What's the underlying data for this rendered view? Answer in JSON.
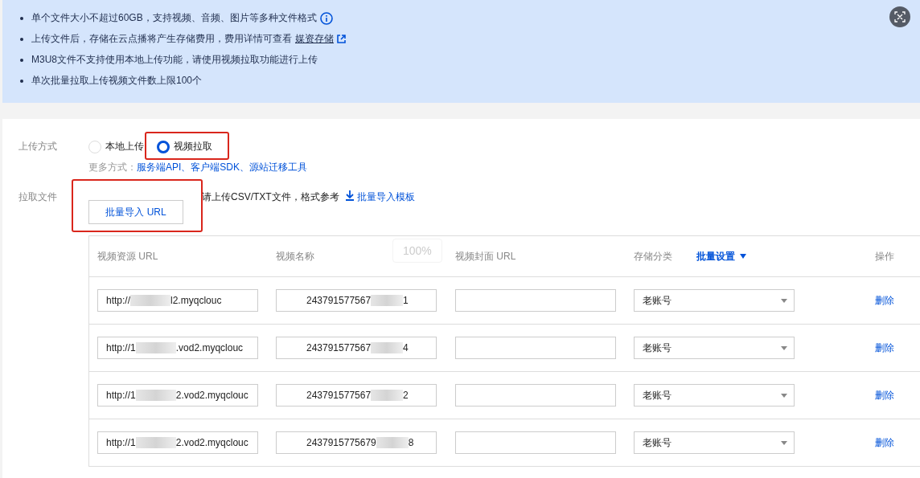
{
  "notice": {
    "items": [
      {
        "text": "单个文件大小不超过60GB，支持视频、音频、图片等多种文件格式",
        "info": true
      },
      {
        "text": "上传文件后，存储在云点播将产生存储费用，费用详情可查看",
        "link": "媒资存储"
      },
      {
        "text": "M3U8文件不支持使用本地上传功能，请使用视频拉取功能进行上传"
      },
      {
        "text": "单次批量拉取上传视频文件数上限100个"
      }
    ]
  },
  "upload_method": {
    "label": "上传方式",
    "options": [
      {
        "label": "本地上传",
        "selected": false
      },
      {
        "label": "视频拉取",
        "selected": true
      }
    ],
    "more_label": "更多方式：",
    "more_links": [
      "服务端API",
      "客户端SDK",
      "源站迁移工具"
    ],
    "separator": "、"
  },
  "pull_files": {
    "label": "拉取文件",
    "button": "批量导入 URL",
    "hint": "请上传CSV/TXT文件，格式参考",
    "template_link": "批量导入模板"
  },
  "zoom_indicator": "100%",
  "table": {
    "columns": [
      {
        "label": "视频资源 URL"
      },
      {
        "label": "视频名称"
      },
      {
        "label": "视频封面 URL"
      },
      {
        "label": "存储分类",
        "action": "批量设置"
      },
      {
        "label": "操作"
      }
    ],
    "rows": [
      {
        "url_start": "http://",
        "url_end": "l2.myqclouc",
        "name_start": "243791577567",
        "name_end": "1",
        "category": "老账号",
        "action": "删除"
      },
      {
        "url_start": "http://1",
        "url_end": ".vod2.myqclouc",
        "name_start": "243791577567",
        "name_end": "4",
        "category": "老账号",
        "action": "删除"
      },
      {
        "url_start": "http://1",
        "url_end": "2.vod2.myqclouc",
        "name_start": "243791577567",
        "name_end": "2",
        "category": "老账号",
        "action": "删除"
      },
      {
        "url_start": "http://1",
        "url_end": "2.vod2.myqclouc",
        "name_start": "2437915775679",
        "name_end": "8",
        "category": "老账号",
        "action": "删除"
      }
    ]
  }
}
